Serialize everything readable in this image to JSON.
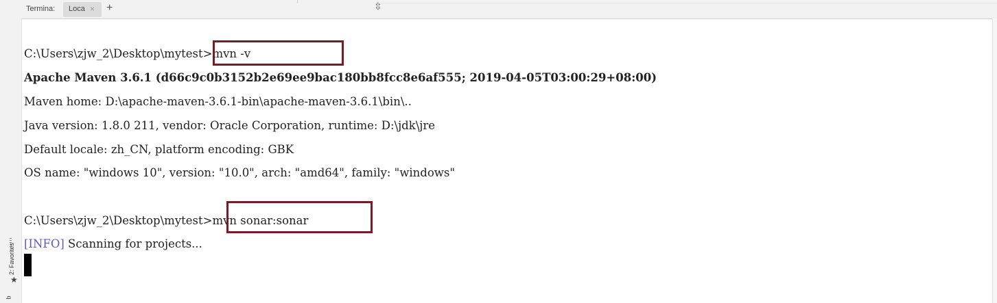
{
  "tabs": {
    "terminal_label": "Termina:",
    "local_label": "Loca",
    "close_glyph": "×",
    "add_glyph": "+"
  },
  "sidebar": {
    "favorites_label": "2: Favorites",
    "star_glyph": "★",
    "bottom_label": "b"
  },
  "terminal": {
    "lines": [
      "C:\\Users\\zjw_2\\Desktop\\mytest>mvn -v",
      "Apache Maven 3.6.1 (d66c9c0b3152b2e69ee9bac180bb8fcc8e6af555; 2019-04-05T03:00:29+08:00)",
      "Maven home: D:\\apache-maven-3.6.1-bin\\apache-maven-3.6.1\\bin\\..",
      "Java version: 1.8.0 211, vendor: Oracle Corporation, runtime: D:\\jdk\\jre",
      "Default locale: zh_CN, platform encoding: GBK",
      "OS name: \"windows 10\", version: \"10.0\", arch: \"amd64\", family: \"windows\"",
      "C:\\Users\\zjw_2\\Desktop\\mytest>mvn sonar:sonar"
    ],
    "info_tag": "[INFO]",
    "info_text": " Scanning for projects..."
  },
  "colors": {
    "highlight_box": "#7a1a24",
    "info_tag": "#5a5ac8",
    "background": "#ffffff"
  }
}
